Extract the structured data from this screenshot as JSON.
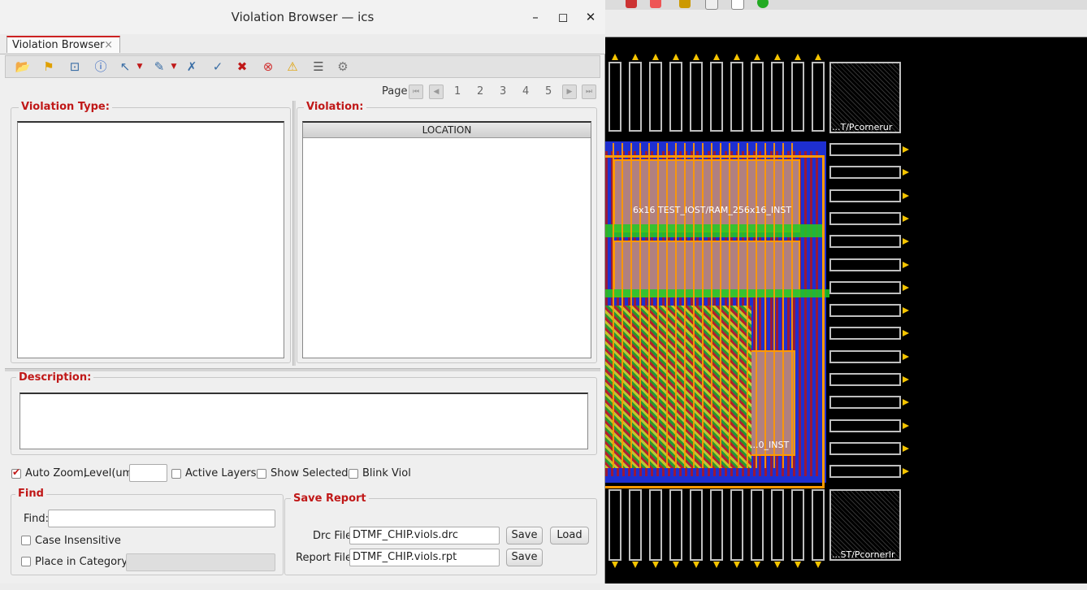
{
  "window": {
    "title": "Violation Browser — ics"
  },
  "tab": {
    "label": "Violation Browser",
    "close": "×"
  },
  "pager": {
    "label": "Page:",
    "pages": [
      "1",
      "2",
      "3",
      "4",
      "5"
    ]
  },
  "violation_type": {
    "label": "Violation Type:"
  },
  "violation": {
    "label": "Violation:",
    "column": "LOCATION"
  },
  "description": {
    "label": "Description:"
  },
  "options": {
    "auto_zoom": "Auto Zoom;",
    "level_label": "Level(um)",
    "level_value": "",
    "active_layers": "Active Layers",
    "show_selected": "Show Selected",
    "blink_viol": "Blink Viol"
  },
  "find": {
    "group": "Find",
    "label": "Find:",
    "value": "",
    "case_insensitive": "Case Insensitive",
    "place_in_category": "Place in Category"
  },
  "save_report": {
    "group": "Save Report",
    "drc_label": "Drc File:",
    "drc_value": "DTMF_CHIP.viols.drc",
    "report_label": "Report File:",
    "report_value": "DTMF_CHIP.viols.rpt",
    "save": "Save",
    "load": "Load"
  },
  "layout": {
    "label_top_right": "...T/Pcornerur",
    "label_bottom_right": "...ST/Pcornerlr",
    "label_ram1": "6x16 TEST_IOST/RAM_256x16_INST",
    "label_ram2": "...0_INST"
  },
  "colors": {
    "accent": "#c01818",
    "pad": "#f5c400",
    "metal": "#ff9900"
  }
}
